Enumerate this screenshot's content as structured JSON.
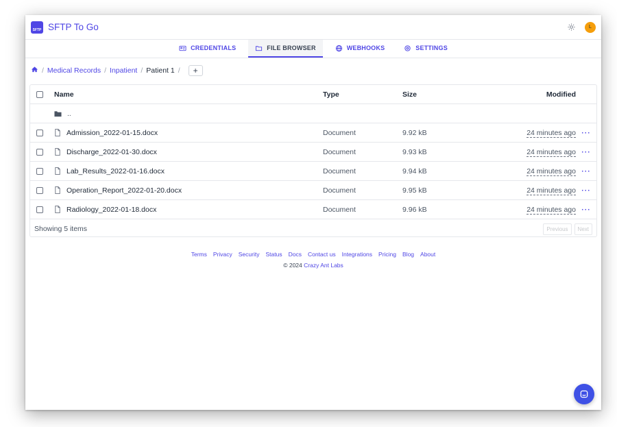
{
  "app": {
    "logo_text": "SFTP",
    "title": "SFTP To Go",
    "avatar_initial": "L"
  },
  "tabs": [
    {
      "label": "CREDENTIALS",
      "icon": "id-card-icon"
    },
    {
      "label": "FILE BROWSER",
      "icon": "folder-icon",
      "active": true
    },
    {
      "label": "WEBHOOKS",
      "icon": "globe-icon"
    },
    {
      "label": "SETTINGS",
      "icon": "gear-icon"
    }
  ],
  "breadcrumb": {
    "items": [
      "Medical Records",
      "Inpatient"
    ],
    "current": "Patient 1",
    "separator": "/",
    "add_label": "+"
  },
  "table": {
    "headers": {
      "name": "Name",
      "type": "Type",
      "size": "Size",
      "modified": "Modified"
    },
    "parent_label": "..",
    "rows": [
      {
        "name": "Admission_2022-01-15.docx",
        "type": "Document",
        "size": "9.92 kB",
        "modified": "24 minutes ago"
      },
      {
        "name": "Discharge_2022-01-30.docx",
        "type": "Document",
        "size": "9.93 kB",
        "modified": "24 minutes ago"
      },
      {
        "name": "Lab_Results_2022-01-16.docx",
        "type": "Document",
        "size": "9.94 kB",
        "modified": "24 minutes ago"
      },
      {
        "name": "Operation_Report_2022-01-20.docx",
        "type": "Document",
        "size": "9.95 kB",
        "modified": "24 minutes ago"
      },
      {
        "name": "Radiology_2022-01-18.docx",
        "type": "Document",
        "size": "9.96 kB",
        "modified": "24 minutes ago"
      }
    ],
    "actions_label": "···",
    "summary": "Showing 5 items",
    "previous_label": "Previous",
    "next_label": "Next"
  },
  "footer": {
    "links": [
      "Terms",
      "Privacy",
      "Security",
      "Status",
      "Docs",
      "Contact us",
      "Integrations",
      "Pricing",
      "Blog",
      "About"
    ],
    "copyright_prefix": "© 2024",
    "company": "Crazy Ant Labs"
  },
  "colors": {
    "accent": "#4f46e5",
    "avatar": "#f59e0b",
    "chat": "#3f51e5"
  }
}
